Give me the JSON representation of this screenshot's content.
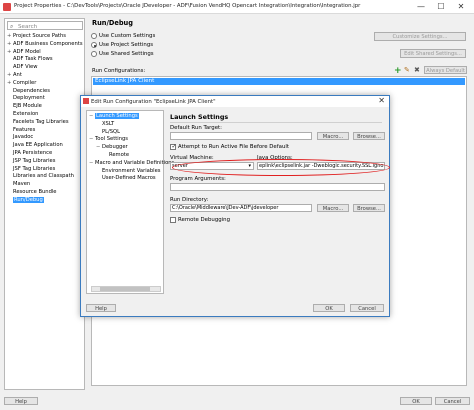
{
  "window": {
    "title": "Project Properties - C:\\DevTools\\Projects\\Oracle JDeveloper - ADF\\Fusion VendHQ Opencart Integration\\Integration\\Integration.jpr",
    "minimize": "—",
    "maximize": "☐",
    "close": "✕"
  },
  "search": {
    "placeholder": "Search"
  },
  "tree": [
    {
      "label": "Project Source Paths",
      "expander": "+"
    },
    {
      "label": "ADF Business Components",
      "expander": "+"
    },
    {
      "label": "ADF Model",
      "expander": "+"
    },
    {
      "label": "ADF Task Flows",
      "expander": ""
    },
    {
      "label": "ADF View",
      "expander": ""
    },
    {
      "label": "Ant",
      "expander": "+"
    },
    {
      "label": "Compiler",
      "expander": "+"
    },
    {
      "label": "Dependencies",
      "expander": ""
    },
    {
      "label": "Deployment",
      "expander": ""
    },
    {
      "label": "EJB Module",
      "expander": ""
    },
    {
      "label": "Extension",
      "expander": ""
    },
    {
      "label": "Facelets Tag Libraries",
      "expander": ""
    },
    {
      "label": "Features",
      "expander": ""
    },
    {
      "label": "Javadoc",
      "expander": ""
    },
    {
      "label": "Java EE Application",
      "expander": ""
    },
    {
      "label": "JPA Persistence",
      "expander": ""
    },
    {
      "label": "JSP Tag Libraries",
      "expander": ""
    },
    {
      "label": "JSF Tag Libraries",
      "expander": ""
    },
    {
      "label": "Libraries and Classpath",
      "expander": ""
    },
    {
      "label": "Maven",
      "expander": ""
    },
    {
      "label": "Resource Bundle",
      "expander": ""
    },
    {
      "label": "Run/Debug",
      "expander": ""
    }
  ],
  "main": {
    "title": "Run/Debug",
    "radio_custom": "Use Custom Settings",
    "radio_project": "Use Project Settings",
    "radio_shared": "Use Shared Settings",
    "customize_btn": "Customize Settings...",
    "edit_shared_btn": "Edit Shared Settings...",
    "run_configs_label": "Run Configurations:",
    "selected_config": "EclipseLink JPA Client",
    "add_icon": "plus-icon",
    "edit_icon": "pencil-icon",
    "delete_icon": "x-icon",
    "always_default_btn": "Always Default"
  },
  "modal": {
    "title": "Edit Run Configuration \"EclipseLink JPA Client\"",
    "close": "✕",
    "tree": [
      {
        "label": "Launch Settings",
        "level": 0,
        "expander": "−"
      },
      {
        "label": "XSLT",
        "level": 1,
        "expander": ""
      },
      {
        "label": "PL/SQL",
        "level": 1,
        "expander": ""
      },
      {
        "label": "Tool Settings",
        "level": 0,
        "expander": "−"
      },
      {
        "label": "Debugger",
        "level": 1,
        "expander": "−"
      },
      {
        "label": "Remote",
        "level": 2,
        "expander": ""
      },
      {
        "label": "Macro and Variable Definitions",
        "level": 0,
        "expander": "−"
      },
      {
        "label": "Environment Variables",
        "level": 1,
        "expander": ""
      },
      {
        "label": "User-Defined Macros",
        "level": 1,
        "expander": ""
      }
    ],
    "section_title": "Launch Settings",
    "default_run_target_label": "Default Run Target:",
    "default_run_target_value": "",
    "macro_btn": "Macro...",
    "browse_btn": "Browse...",
    "attempt_run_active": "Attempt to Run Active File Before Default",
    "virtual_machine_label": "Virtual Machine:",
    "virtual_machine_value": "server",
    "java_options_label": "Java Options:",
    "java_options_value": "eplink\\eclipselink.jar -Dweblogic.security.SSL.ignoreHostnameVerification=true",
    "program_args_label": "Program Arguments:",
    "program_args_value": "",
    "run_directory_label": "Run Directory:",
    "run_directory_value": "C:\\Oracle\\Middleware\\JDev-ADF\\jdeveloper",
    "remote_debugging": "Remote Debugging",
    "help_btn": "Help",
    "ok_btn": "OK",
    "cancel_btn": "Cancel"
  },
  "footer": {
    "help_btn": "Help",
    "ok_btn": "OK",
    "cancel_btn": "Cancel"
  }
}
